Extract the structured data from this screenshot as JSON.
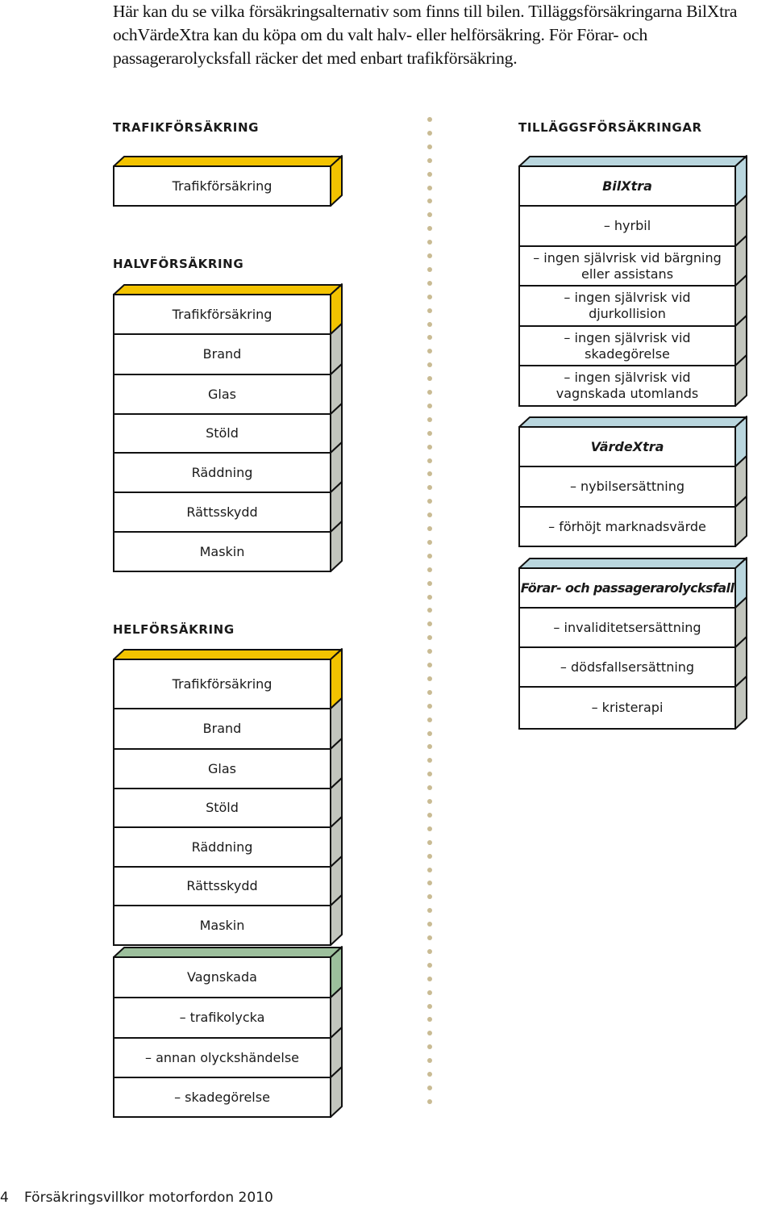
{
  "intro": "Här kan du se vilka försäkringsalternativ som finns till bilen. Tilläggsförsäkringarna BilXtra ochVärdeXtra kan du köpa om du valt halv- eller helförsäkring. För Förar- och passagerarolycksfall räcker det med enbart trafikförsäkring.",
  "colors": {
    "yellow": "#f3c300",
    "blue": "#b9d6de",
    "green": "#9cbf9c",
    "gray": "#c2c5bd",
    "dot": "#c9bb93"
  },
  "left": {
    "heading": "TRAFIKFÖRSÄKRING",
    "trafik_block": {
      "rows": [
        {
          "label": "Trafikförsäkring",
          "color": "yellow"
        }
      ]
    },
    "halv_heading": "HALVFÖRSÄKRING",
    "halv_block": {
      "rows": [
        {
          "label": "Trafikförsäkring",
          "color": "yellow"
        },
        {
          "label": "Brand",
          "color": "gray"
        },
        {
          "label": "Glas",
          "color": "gray"
        },
        {
          "label": "Stöld",
          "color": "gray"
        },
        {
          "label": "Räddning",
          "color": "gray"
        },
        {
          "label": "Rättsskydd",
          "color": "gray"
        },
        {
          "label": "Maskin",
          "color": "gray"
        }
      ]
    },
    "hel_heading": "HELFÖRSÄKRING",
    "hel_block": {
      "rows": [
        {
          "label": "Trafikförsäkring",
          "color": "yellow"
        },
        {
          "label": "Brand",
          "color": "gray"
        },
        {
          "label": "Glas",
          "color": "gray"
        },
        {
          "label": "Stöld",
          "color": "gray"
        },
        {
          "label": "Räddning",
          "color": "gray"
        },
        {
          "label": "Rättsskydd",
          "color": "gray"
        },
        {
          "label": "Maskin",
          "color": "gray"
        }
      ]
    },
    "vagnskada_block": {
      "rows": [
        {
          "label": "Vagnskada",
          "color": "green"
        },
        {
          "label": "– trafikolycka",
          "color": "gray"
        },
        {
          "label": "– annan olyckshändelse",
          "color": "gray"
        },
        {
          "label": "– skadegörelse",
          "color": "gray"
        }
      ]
    }
  },
  "right": {
    "heading": "TILLÄGGSFÖRSÄKRINGAR",
    "bilxtra_block": {
      "rows": [
        {
          "label": "BilXtra",
          "color": "blue",
          "title": true
        },
        {
          "label": "– hyrbil",
          "color": "gray"
        },
        {
          "label": "– ingen självrisk vid bärgning\neller assistans",
          "color": "gray"
        },
        {
          "label": "– ingen självrisk vid\ndjurkollision",
          "color": "gray"
        },
        {
          "label": "– ingen självrisk vid\nskadegörelse",
          "color": "gray"
        },
        {
          "label": "– ingen självrisk vid\nvagnskada utomlands",
          "color": "gray"
        }
      ]
    },
    "vardextra_block": {
      "rows": [
        {
          "label": "VärdeXtra",
          "color": "blue",
          "title": true
        },
        {
          "label": "– nybilsersättning",
          "color": "gray"
        },
        {
          "label": "– förhöjt marknadsvärde",
          "color": "gray"
        }
      ]
    },
    "olycksfall_block": {
      "rows": [
        {
          "label": "Förar- och passagerarolycksfall",
          "color": "blue",
          "title": true
        },
        {
          "label": "– invaliditetsersättning",
          "color": "gray"
        },
        {
          "label": "– dödsfallsersättning",
          "color": "gray"
        },
        {
          "label": "– kristerapi",
          "color": "gray"
        }
      ]
    }
  },
  "footer": {
    "page_number": "4",
    "document_title": "Försäkringsvillkor motorfordon 2010"
  }
}
